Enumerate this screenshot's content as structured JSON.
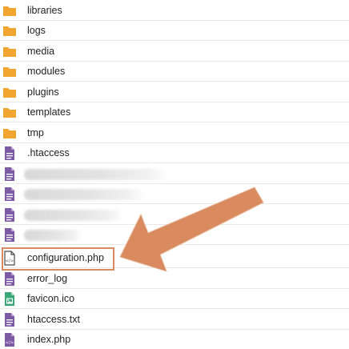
{
  "colors": {
    "folder": "#f2a531",
    "file_purple": "#7d5aa4",
    "file_green": "#3aa876",
    "annotation": "#d98a5f"
  },
  "files": [
    {
      "name": "libraries",
      "type": "folder",
      "icon": "folder-icon"
    },
    {
      "name": "logs",
      "type": "folder",
      "icon": "folder-icon"
    },
    {
      "name": "media",
      "type": "folder",
      "icon": "folder-icon"
    },
    {
      "name": "modules",
      "type": "folder",
      "icon": "folder-icon"
    },
    {
      "name": "plugins",
      "type": "folder",
      "icon": "folder-icon"
    },
    {
      "name": "templates",
      "type": "folder",
      "icon": "folder-icon"
    },
    {
      "name": "tmp",
      "type": "folder",
      "icon": "folder-icon"
    },
    {
      "name": ".htaccess",
      "type": "file",
      "icon": "file-icon"
    },
    {
      "name": "",
      "type": "file",
      "icon": "file-icon",
      "redacted": true
    },
    {
      "name": "",
      "type": "file",
      "icon": "file-icon",
      "redacted": true
    },
    {
      "name": "",
      "type": "file",
      "icon": "file-icon",
      "redacted": true
    },
    {
      "name": "",
      "type": "file",
      "icon": "file-icon",
      "redacted": true
    },
    {
      "name": "configuration.php",
      "type": "php",
      "icon": "php-file-icon",
      "highlighted": true
    },
    {
      "name": "error_log",
      "type": "file",
      "icon": "file-icon"
    },
    {
      "name": "favicon.ico",
      "type": "image",
      "icon": "image-file-icon"
    },
    {
      "name": "htaccess.txt",
      "type": "file",
      "icon": "file-icon"
    },
    {
      "name": "index.php",
      "type": "php",
      "icon": "php-file-icon"
    }
  ]
}
